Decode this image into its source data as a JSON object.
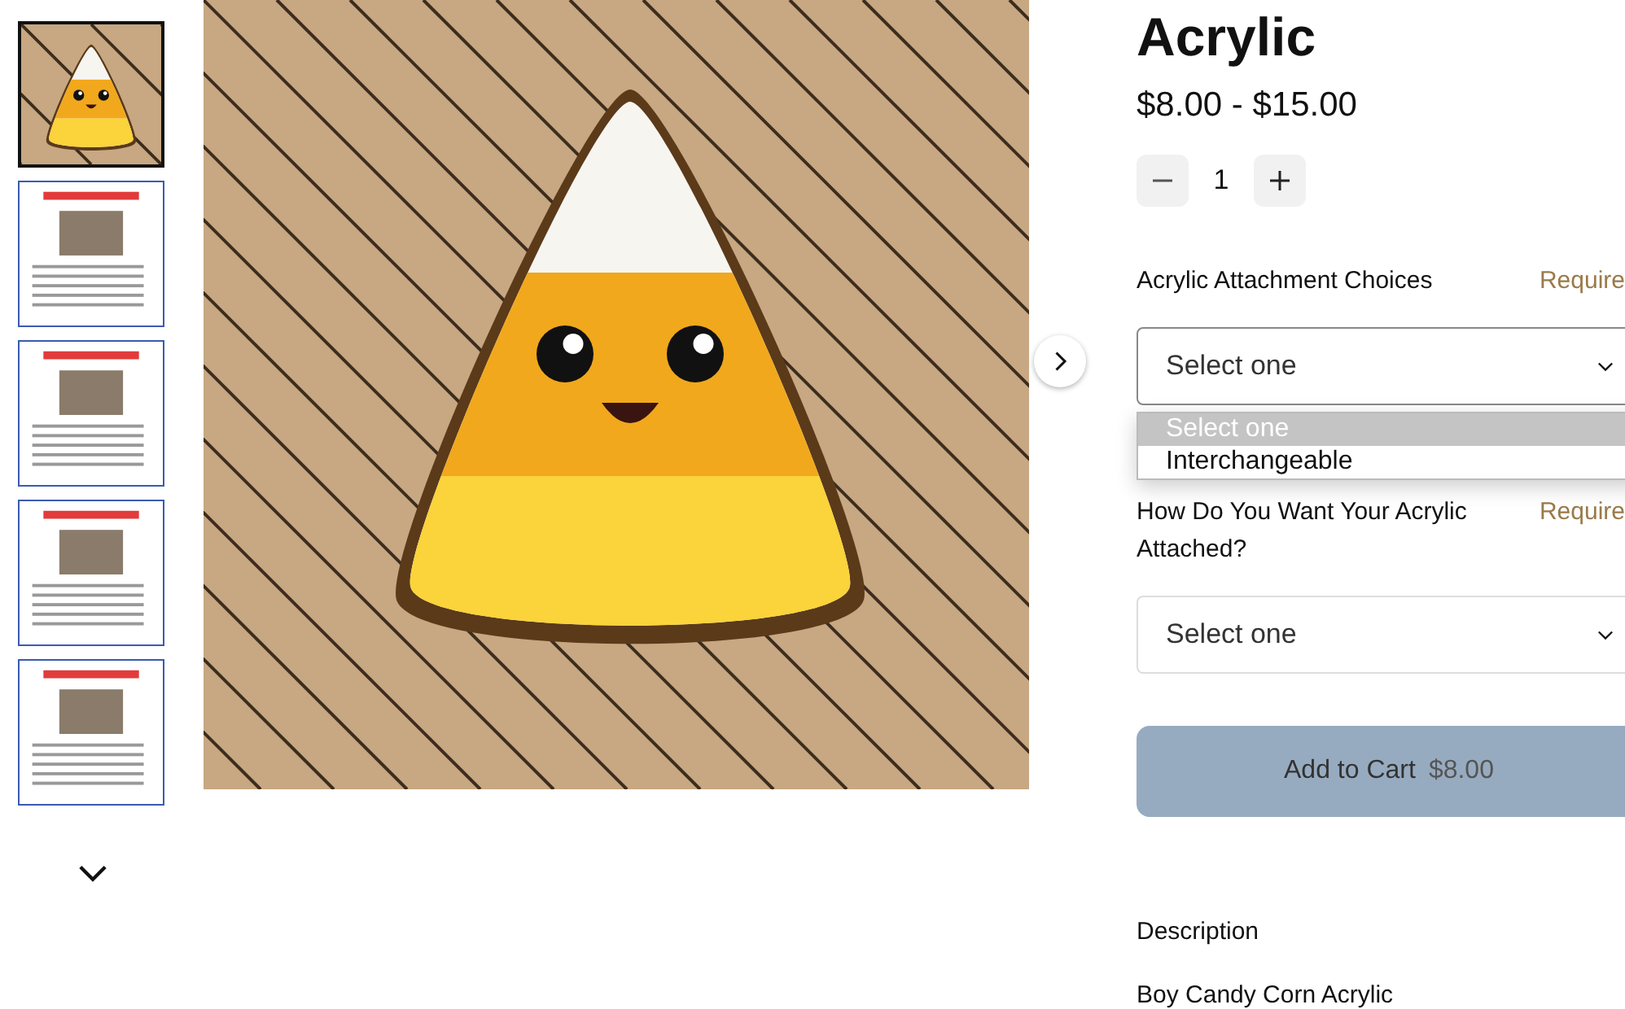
{
  "thumbnails": [
    {
      "kind": "photo",
      "selected": true
    },
    {
      "kind": "document",
      "selected": false
    },
    {
      "kind": "document",
      "selected": false
    },
    {
      "kind": "document",
      "selected": false
    },
    {
      "kind": "document",
      "selected": false
    }
  ],
  "product": {
    "title": "Acrylic",
    "price": "$8.00 - $15.00",
    "quantity": "1"
  },
  "options": [
    {
      "label": "Acrylic Attachment Choices",
      "required": "Require",
      "value": "Select one",
      "expanded": true,
      "menu": [
        {
          "label": "Select one",
          "selected": true
        },
        {
          "label": "Interchangeable",
          "selected": false
        }
      ]
    },
    {
      "label": "How Do You Want Your Acrylic Attached?",
      "required": "Require",
      "value": "Select one",
      "expanded": false
    }
  ],
  "add_to_cart": {
    "label": "Add to Cart",
    "price": "$8.00",
    "disabled": true
  },
  "description": {
    "heading": "Description",
    "text": "Boy Candy Corn Acrylic"
  }
}
